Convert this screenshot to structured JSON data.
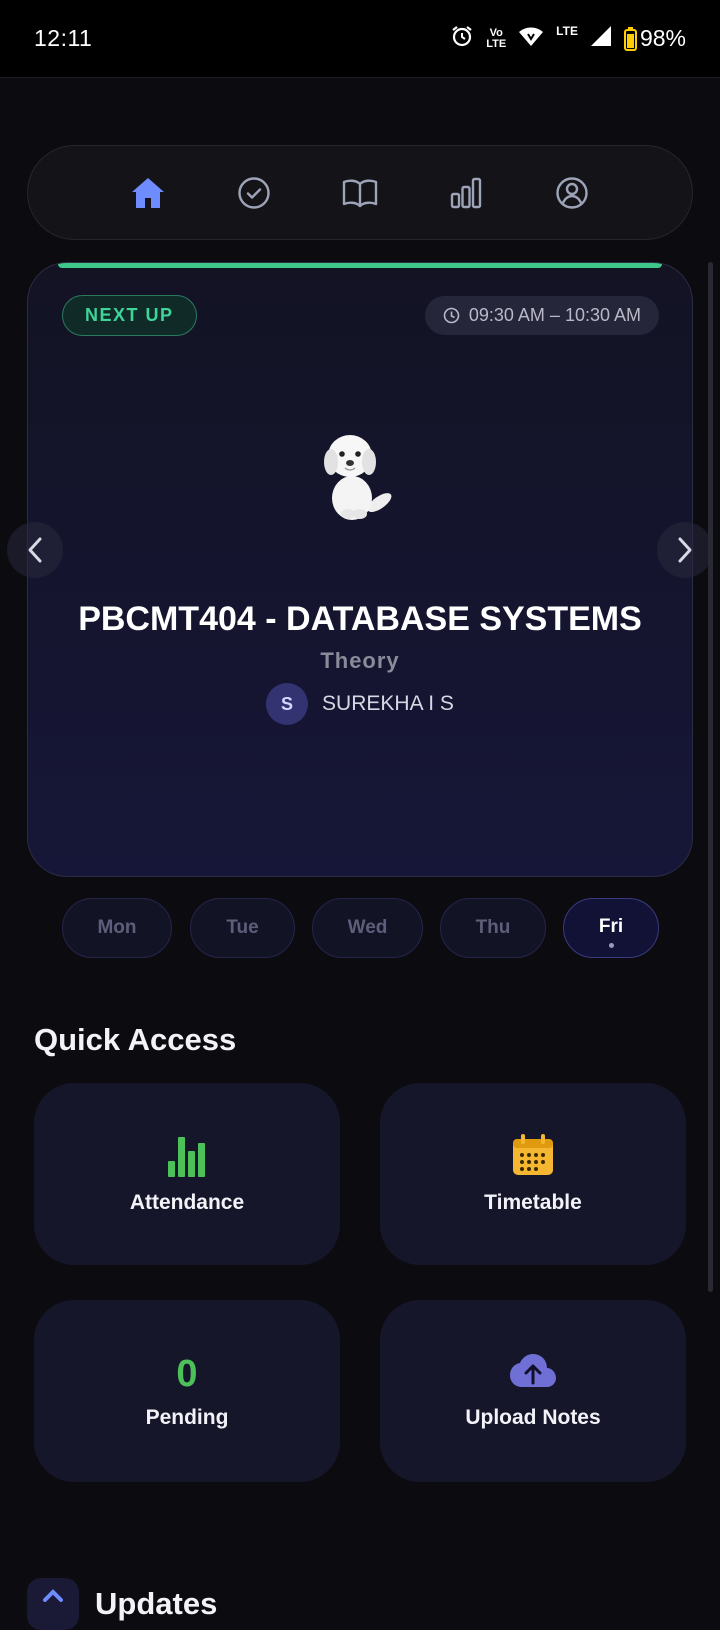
{
  "status_bar": {
    "time": "12:11",
    "volte_line1": "Vo",
    "volte_line2": "LTE",
    "lte": "LTE",
    "battery": "98%"
  },
  "nav": {
    "items": [
      "home-icon",
      "check-circle-icon",
      "book-icon",
      "bar-chart-icon",
      "profile-icon"
    ],
    "active": "home-icon",
    "accent": "#6f8cff"
  },
  "next_class": {
    "badge": "NEXT UP",
    "time_range": "09:30 AM – 10:30 AM",
    "course": "PBCMT404 - DATABASE SYSTEMS",
    "type": "Theory",
    "teacher_initial": "S",
    "teacher_name": "SUREKHA I S",
    "accent": "#3ec98b"
  },
  "days": {
    "items": [
      "Mon",
      "Tue",
      "Wed",
      "Thu",
      "Fri"
    ],
    "selected": "Fri"
  },
  "quick_access": {
    "title": "Quick Access",
    "attendance_label": "Attendance",
    "timetable_label": "Timetable",
    "pending_count": "0",
    "pending_label": "Pending",
    "upload_label": "Upload Notes"
  },
  "updates": {
    "title": "Updates"
  }
}
